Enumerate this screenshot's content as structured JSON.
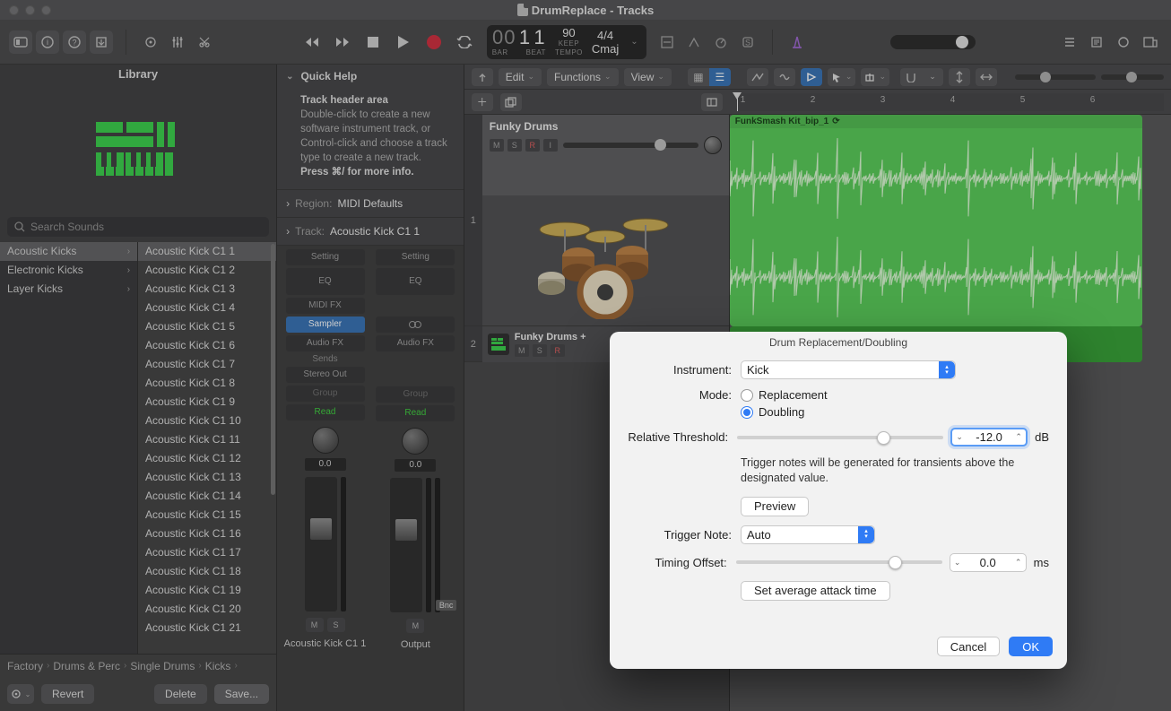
{
  "window": {
    "title": "DrumReplace - Tracks"
  },
  "lcd": {
    "bars": "00",
    "beat": "1",
    "div": "1",
    "bar_lbl": "BAR",
    "beat_lbl": "BEAT",
    "tempo": "90",
    "tempo_sub": "KEEP",
    "tempo_lbl": "TEMPO",
    "sig": "4/4",
    "key": "Cmaj"
  },
  "library": {
    "title": "Library",
    "search_placeholder": "Search Sounds",
    "categories": [
      {
        "label": "Acoustic Kicks",
        "selected": true
      },
      {
        "label": "Electronic Kicks",
        "selected": false
      },
      {
        "label": "Layer Kicks",
        "selected": false
      }
    ],
    "patches": [
      "Acoustic Kick C1 1",
      "Acoustic Kick C1 2",
      "Acoustic Kick C1 3",
      "Acoustic Kick C1 4",
      "Acoustic Kick C1 5",
      "Acoustic Kick C1 6",
      "Acoustic Kick C1 7",
      "Acoustic Kick C1 8",
      "Acoustic Kick C1 9",
      "Acoustic Kick C1 10",
      "Acoustic Kick C1 11",
      "Acoustic Kick C1 12",
      "Acoustic Kick C1 13",
      "Acoustic Kick C1 14",
      "Acoustic Kick C1 15",
      "Acoustic Kick C1 16",
      "Acoustic Kick C1 17",
      "Acoustic Kick C1 18",
      "Acoustic Kick C1 19",
      "Acoustic Kick C1 20",
      "Acoustic Kick C1 21"
    ],
    "selected_patch_index": 0,
    "playing_patch_index": 5,
    "breadcrumb": [
      "Factory",
      "Drums & Perc",
      "Single Drums",
      "Kicks"
    ],
    "revert": "Revert",
    "delete": "Delete",
    "save": "Save..."
  },
  "quickhelp": {
    "title": "Quick Help",
    "heading": "Track header area",
    "body_line1": "Double-click to create a new software instrument track, or Control-click and choose a track type to create a new track.",
    "body_line2": "Press ⌘/ for more info."
  },
  "inspector": {
    "region_label": "Region:",
    "region_value": "MIDI Defaults",
    "track_label": "Track:",
    "track_value": "Acoustic Kick C1 1",
    "slots": {
      "setting": "Setting",
      "eq": "EQ",
      "midifx": "MIDI FX",
      "sampler": "Sampler",
      "audiofx": "Audio FX",
      "sends": "Sends",
      "stereo_out": "Stereo Out",
      "group": "Group",
      "read": "Read"
    },
    "knob_val": "0.0",
    "strip1_name": "Acoustic Kick C1 1",
    "strip2_name": "Output",
    "bnc": "Bnc",
    "m": "M",
    "s": "S"
  },
  "arrange": {
    "menus": {
      "edit": "Edit",
      "functions": "Functions",
      "view": "View"
    },
    "ruler_ticks": [
      "1",
      "2",
      "3",
      "4",
      "5",
      "6"
    ],
    "track1": {
      "name": "Funky Drums",
      "region_name": "FunkSmash Kit_bip_1"
    },
    "track2": {
      "name": "Funky Drums +"
    },
    "msri": {
      "m": "M",
      "s": "S",
      "r": "R",
      "i": "I"
    }
  },
  "dialog": {
    "title": "Drum Replacement/Doubling",
    "instrument_lbl": "Instrument:",
    "instrument_val": "Kick",
    "mode_lbl": "Mode:",
    "mode_replacement": "Replacement",
    "mode_doubling": "Doubling",
    "mode_selected": "doubling",
    "threshold_lbl": "Relative Threshold:",
    "threshold_val": "-12.0",
    "threshold_unit": "dB",
    "threshold_help": "Trigger notes will be generated for transients above the designated value.",
    "preview": "Preview",
    "trigger_lbl": "Trigger Note:",
    "trigger_val": "Auto",
    "timing_lbl": "Timing Offset:",
    "timing_val": "0.0",
    "timing_unit": "ms",
    "avg_attack": "Set average attack time",
    "cancel": "Cancel",
    "ok": "OK"
  }
}
